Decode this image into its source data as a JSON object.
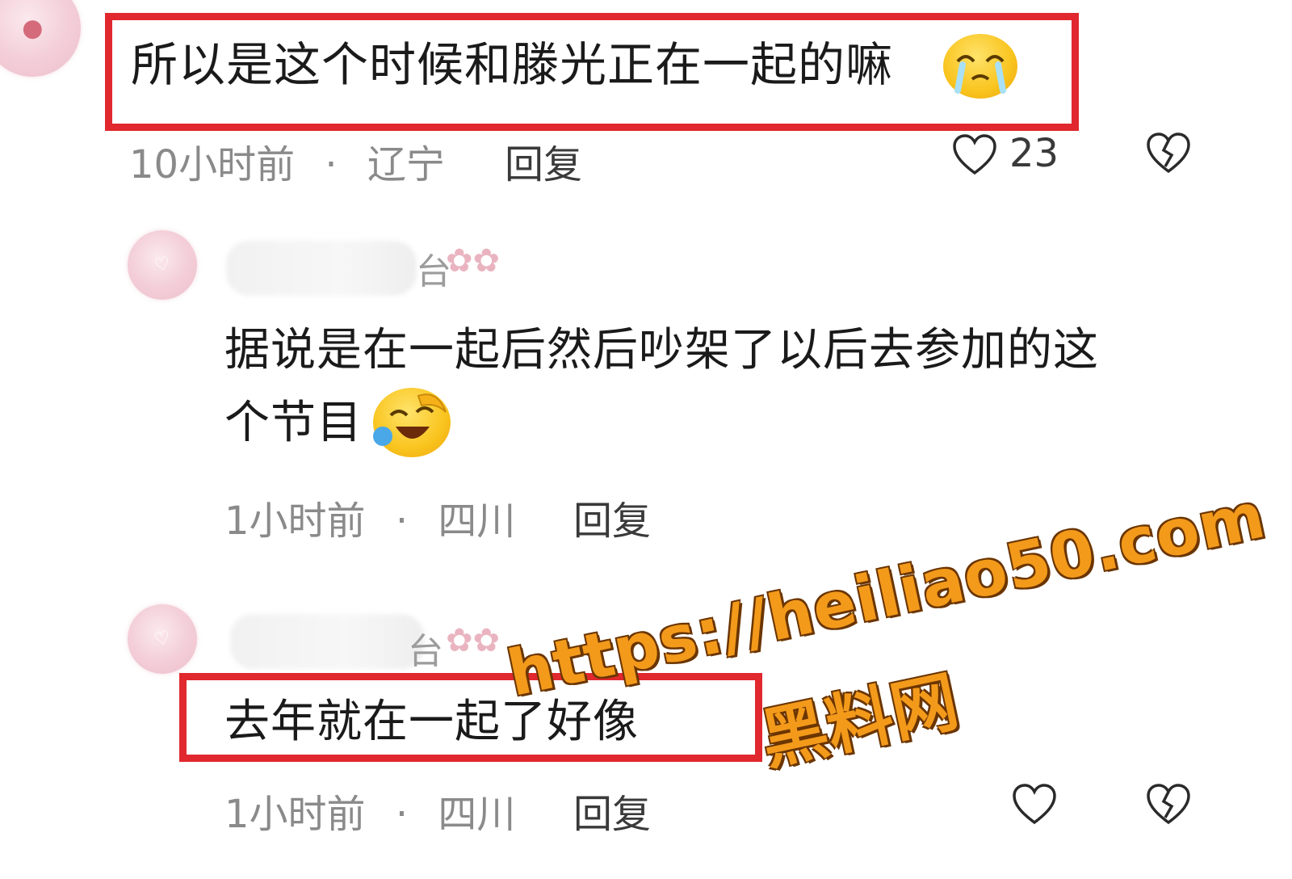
{
  "comment1": {
    "text": "所以是这个时候和滕光正在一起的嘛",
    "time": "10小时前",
    "location": "辽宁",
    "reply": "回复",
    "likes": "23",
    "emoji": "crying-face-emoji"
  },
  "comment2": {
    "name_suffix": "台",
    "text_line1": "据说是在一起后然后吵架了以后去参加的这",
    "text_line2": "个节目",
    "time": "1小时前",
    "location": "四川",
    "reply": "回复",
    "emoji": "tears-of-joy-emoji"
  },
  "comment3": {
    "name_suffix": "台",
    "text": "去年就在一起了好像",
    "time": "1小时前",
    "location": "四川",
    "reply": "回复"
  },
  "watermark": {
    "url": "https://heiliao50.com",
    "name": "黑料网"
  },
  "colors": {
    "highlight_box": "#e0282e",
    "watermark": "#f39a1b",
    "meta_text": "#8a8a8a"
  }
}
